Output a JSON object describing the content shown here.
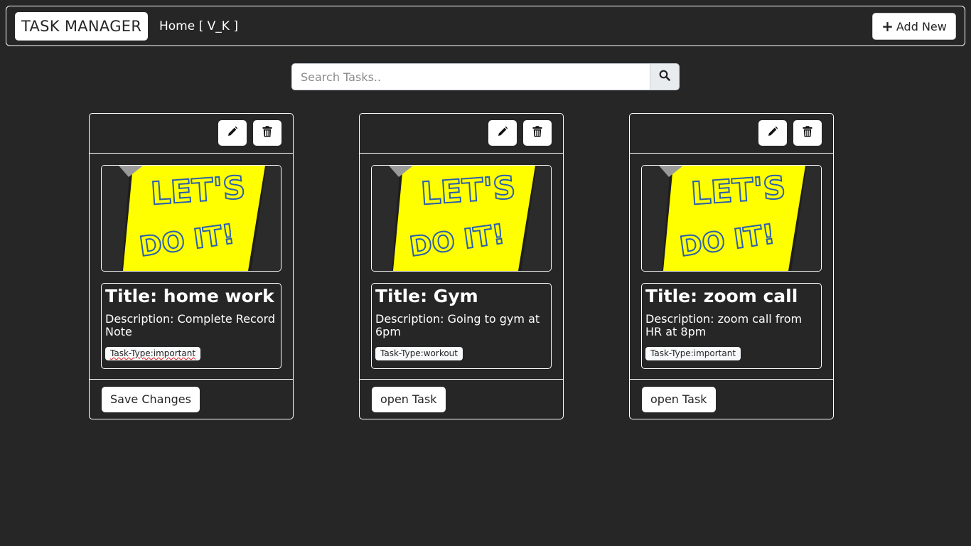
{
  "navbar": {
    "brand": "TASK MANAGER",
    "home_link": "Home [ V_K ]",
    "add_new_label": "Add New",
    "add_new_icon": "plus-icon"
  },
  "search": {
    "placeholder": "Search Tasks..",
    "value": "",
    "button_icon": "search-icon"
  },
  "colors": {
    "background": "#262626",
    "card_border": "#ffffff",
    "note_yellow": "#ffff00",
    "note_text_blue": "#2a5fae"
  },
  "tasks": [
    {
      "image_text_1": "LET'S",
      "image_text_2": "DO IT!",
      "title": "Title: home work",
      "description": "Description: Complete Record Note",
      "badge": "Task-Type:important",
      "footer_button": "Save Changes",
      "edit_icon": "pencil-icon",
      "delete_icon": "trash-icon"
    },
    {
      "image_text_1": "LET'S",
      "image_text_2": "DO IT!",
      "title": "Title: Gym",
      "description": "Description: Going to gym at 6pm",
      "badge": "Task-Type:workout",
      "footer_button": "open Task",
      "edit_icon": "pencil-icon",
      "delete_icon": "trash-icon"
    },
    {
      "image_text_1": "LET'S",
      "image_text_2": "DO IT!",
      "title": "Title: zoom call",
      "description": "Description: zoom call from HR at 8pm",
      "badge": "Task-Type:important",
      "footer_button": "open Task",
      "edit_icon": "pencil-icon",
      "delete_icon": "trash-icon"
    }
  ]
}
